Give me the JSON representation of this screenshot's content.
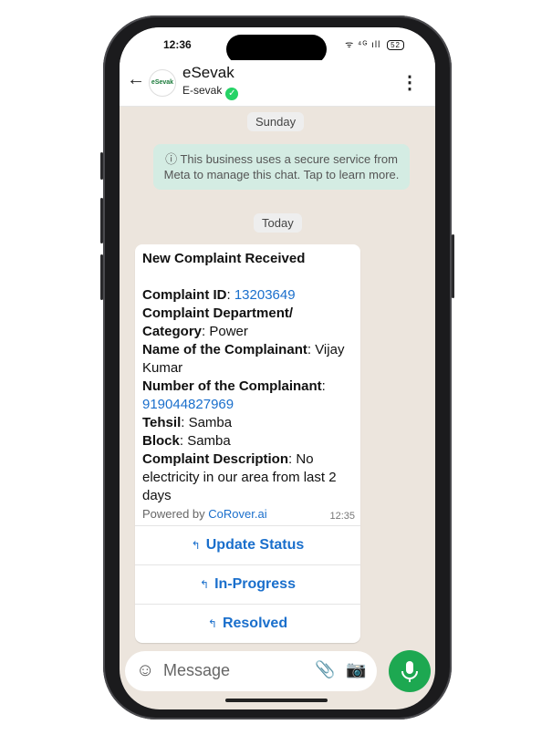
{
  "status_bar": {
    "time": "12:36",
    "network": "ᯤ ⁴ᴳ ıll",
    "battery": "52"
  },
  "header": {
    "back_icon": "←",
    "avatar_text": "eSevak",
    "name": "eSevak",
    "subtitle": "E-sevak",
    "verified_icon": "✓",
    "menu_icon": "⋮"
  },
  "chat": {
    "date_sunday": "Sunday",
    "notice": "ⓘ This business uses a secure service from Meta to manage this chat. Tap to learn more.",
    "date_today": "Today",
    "message": {
      "title": "New Complaint Received",
      "complaint_id_label": "Complaint ID",
      "complaint_id": "13203649",
      "dept_label": "Complaint Department/ Category",
      "dept_value": "Power",
      "name_label": "Name of the Complainant",
      "name_value": "Vijay Kumar",
      "number_label": "Number of the Complainant",
      "number_value": "919044827969",
      "tehsil_label": "Tehsil",
      "tehsil_value": "Samba",
      "block_label": "Block",
      "block_value": "Samba",
      "desc_label": "Complaint Description",
      "desc_value": "No electricity in our area from last 2 days",
      "powered_by": "Powered by",
      "powered_link": "CoRover.ai",
      "time": "12:35"
    },
    "quick_replies": [
      {
        "icon": "↰",
        "label": "Update Status"
      },
      {
        "icon": "↰",
        "label": "In-Progress"
      },
      {
        "icon": "↰",
        "label": "Resolved"
      }
    ]
  },
  "composer": {
    "placeholder": "Message",
    "emoji_icon": "☺",
    "attach_icon": "📎",
    "camera_icon": "📷"
  },
  "colors": {
    "accent": "#1da851",
    "link": "#1a6fcc",
    "chat_bg": "#ece5dd"
  }
}
